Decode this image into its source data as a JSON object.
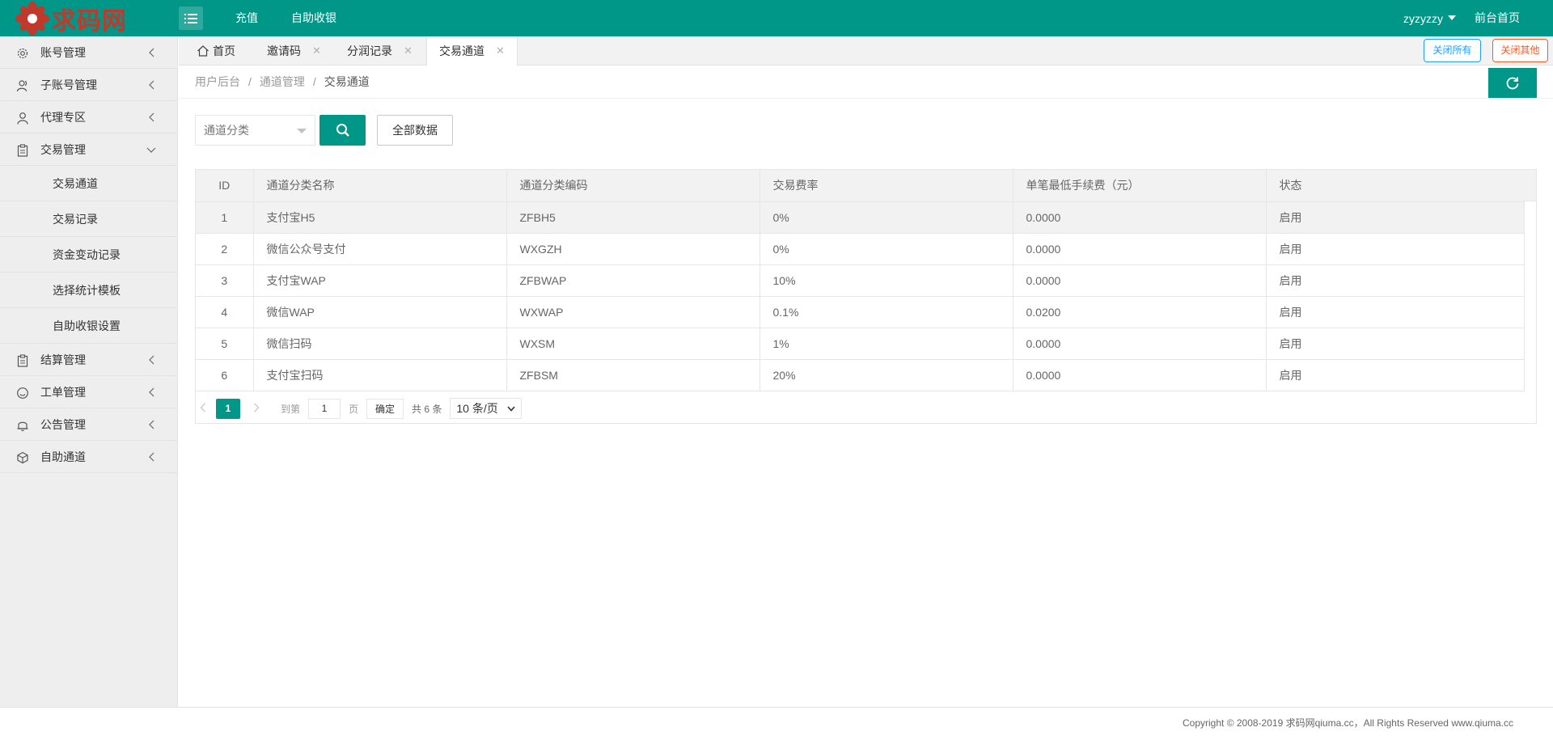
{
  "header": {
    "logo_text": "求码网",
    "nav": {
      "recharge": "充值",
      "cashier": "自助收银"
    },
    "user": "zyzyzzy",
    "front_home": "前台首页",
    "colors": {
      "primary": "#009688",
      "logo": "#c0392b"
    }
  },
  "sidebar": {
    "items": [
      {
        "label": "账号管理",
        "icon": "gear-icon"
      },
      {
        "label": "子账号管理",
        "icon": "users-icon"
      },
      {
        "label": "代理专区",
        "icon": "user-icon"
      },
      {
        "label": "交易管理",
        "icon": "clipboard-icon",
        "expanded": true,
        "children": [
          "交易通道",
          "交易记录",
          "资金变动记录",
          "选择统计模板",
          "自助收银设置"
        ]
      },
      {
        "label": "结算管理",
        "icon": "clipboard-icon"
      },
      {
        "label": "工单管理",
        "icon": "smile-icon"
      },
      {
        "label": "公告管理",
        "icon": "bell-icon"
      },
      {
        "label": "自助通道",
        "icon": "cube-icon"
      }
    ]
  },
  "tabs": [
    {
      "label": "首页",
      "icon": "home-icon",
      "closable": false
    },
    {
      "label": "邀请码",
      "closable": true
    },
    {
      "label": "分润记录",
      "closable": true
    },
    {
      "label": "交易通道",
      "closable": true,
      "active": true
    }
  ],
  "tab_actions": {
    "close_all": "关闭所有",
    "close_other": "关闭其他"
  },
  "breadcrumb": [
    "用户后台",
    "通道管理",
    "交易通道"
  ],
  "filter": {
    "select_placeholder": "通道分类",
    "all_data": "全部数据"
  },
  "table": {
    "columns": [
      "ID",
      "通道分类名称",
      "通道分类编码",
      "交易费率",
      "单笔最低手续费（元）",
      "状态"
    ],
    "rows": [
      [
        "1",
        "支付宝H5",
        "ZFBH5",
        "0%",
        "0.0000",
        "启用"
      ],
      [
        "2",
        "微信公众号支付",
        "WXGZH",
        "0%",
        "0.0000",
        "启用"
      ],
      [
        "3",
        "支付宝WAP",
        "ZFBWAP",
        "10%",
        "0.0000",
        "启用"
      ],
      [
        "4",
        "微信WAP",
        "WXWAP",
        "0.1%",
        "0.0200",
        "启用"
      ],
      [
        "5",
        "微信扫码",
        "WXSM",
        "1%",
        "0.0000",
        "启用"
      ],
      [
        "6",
        "支付宝扫码",
        "ZFBSM",
        "20%",
        "0.0000",
        "启用"
      ]
    ]
  },
  "pagination": {
    "current": "1",
    "goto_label": "到第",
    "goto_value": "1",
    "page_unit": "页",
    "confirm": "确定",
    "total": "共 6 条",
    "limit": "10 条/页"
  },
  "footer": {
    "copyright": "Copyright © 2008-2019 求码网qiuma.cc，All Rights Reserved www.qiuma.cc"
  }
}
